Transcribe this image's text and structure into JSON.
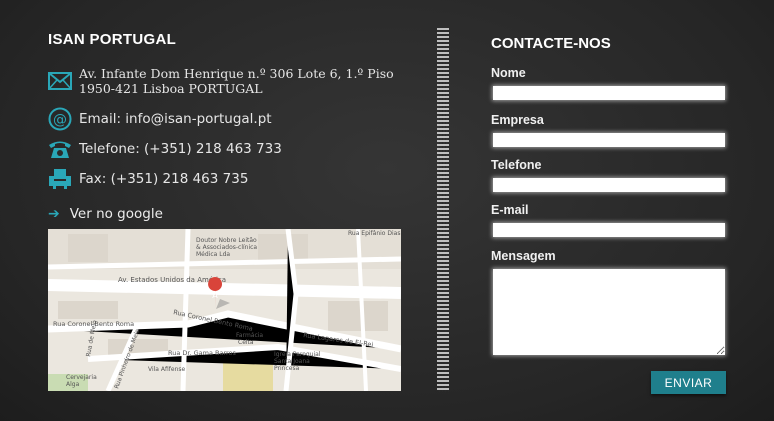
{
  "company": {
    "name": "ISAN PORTUGAL",
    "address_line1": "Av. Infante Dom Henrique n.º 306 Lote 6, 1.º Piso",
    "address_line2": "1950-421 Lisboa PORTUGAL",
    "email": "Email: info@isan-portugal.pt",
    "phone": "Telefone: (+351) 218 463 733",
    "fax": "Fax: (+351) 218 463 735",
    "map_link": "Ver no google"
  },
  "map": {
    "labels": {
      "clinic": "Doutor Nobre Leitão",
      "clinic2": "& Associados-clínica",
      "clinic3": "Médica Lda",
      "epifanio": "Rua Epifânio Dias",
      "avenue": "Av. Estados Unidos da América",
      "bento1": "Rua Coronel Bento Roma",
      "bento2": "Rua Coronel Bento Roma",
      "lagares": "Rua Lagares de El-Rei",
      "pharmacy": "Farmácia",
      "pharmacy2": "Celta",
      "gama": "Rua Dr. Gama Barros",
      "afinense": "Vila Afifense",
      "church": "Igreja Paroquial",
      "church2": "Santa Joana",
      "church3": "Princesa",
      "brewery": "Cervejaria",
      "brewery2": "Alga",
      "pinheiro": "Rua Pinheiro de Melo",
      "melo": "Rua de Melo",
      "marker": "A"
    },
    "colors": {
      "road": "#ffffff",
      "ground": "#ebe7df",
      "block": "#dcd6cc",
      "marker": "#d9443a"
    }
  },
  "form": {
    "title": "CONTACTE-NOS",
    "name_label": "Nome",
    "company_label": "Empresa",
    "phone_label": "Telefone",
    "email_label": "E-mail",
    "message_label": "Mensagem",
    "submit_label": "ENVIAR"
  },
  "colors": {
    "accent": "#2aa7b8",
    "button": "#1f7f8c",
    "background": "#2b2b2b"
  },
  "icons": [
    "envelope-icon",
    "at-icon",
    "telephone-icon",
    "fax-icon",
    "arrow-right-icon",
    "map-marker-icon"
  ]
}
